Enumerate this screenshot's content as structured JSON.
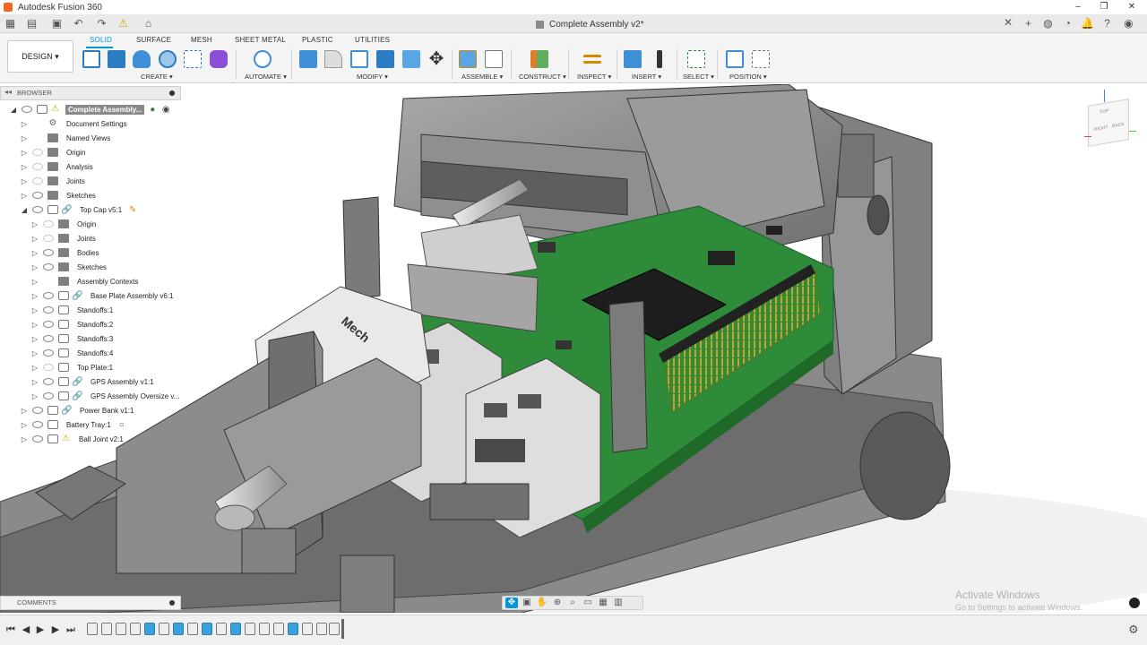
{
  "window": {
    "title": "Autodesk Fusion 360",
    "document_tab": "Complete Assembly v2*",
    "controls": [
      "–",
      "❐",
      "✕"
    ]
  },
  "toolbar": {
    "workspace": "DESIGN",
    "tabs": [
      "SOLID",
      "SURFACE",
      "MESH",
      "SHEET METAL",
      "PLASTIC",
      "UTILITIES"
    ],
    "active_tab": "SOLID",
    "groups": [
      "CREATE",
      "AUTOMATE",
      "MODIFY",
      "ASSEMBLE",
      "CONSTRUCT",
      "INSPECT",
      "INSERT",
      "SELECT",
      "POSITION"
    ]
  },
  "browser": {
    "title": "BROWSER",
    "root": "Complete Assembly...",
    "items": [
      {
        "label": "Document Settings",
        "icon": "gear-icon"
      },
      {
        "label": "Named Views",
        "icon": "folder-icon"
      },
      {
        "label": "Origin",
        "icon": "folder-icon"
      },
      {
        "label": "Analysis",
        "icon": "folder-icon"
      },
      {
        "label": "Joints",
        "icon": "folder-icon"
      },
      {
        "label": "Sketches",
        "icon": "folder-icon"
      },
      {
        "label": "Top Cap v5:1",
        "icon": "component-icon"
      },
      {
        "label": "Origin",
        "icon": "folder-icon"
      },
      {
        "label": "Joints",
        "icon": "folder-icon"
      },
      {
        "label": "Bodies",
        "icon": "folder-icon"
      },
      {
        "label": "Sketches",
        "icon": "folder-icon"
      },
      {
        "label": "Assembly Contexts",
        "icon": "folder-icon"
      },
      {
        "label": "Base Plate Assembly v6:1",
        "icon": "component-icon"
      },
      {
        "label": "Standoffs:1",
        "icon": "component-icon"
      },
      {
        "label": "Standoffs:2",
        "icon": "component-icon"
      },
      {
        "label": "Standoffs:3",
        "icon": "component-icon"
      },
      {
        "label": "Standoffs:4",
        "icon": "component-icon"
      },
      {
        "label": "Top Plate:1",
        "icon": "component-icon"
      },
      {
        "label": "GPS Assembly v1:1",
        "icon": "component-icon"
      },
      {
        "label": "GPS Assembly Oversize v...",
        "icon": "component-icon"
      },
      {
        "label": "Power Bank v1:1",
        "icon": "component-icon"
      },
      {
        "label": "Battery Tray:1",
        "icon": "component-icon"
      },
      {
        "label": "Ball Joint v2:1",
        "icon": "component-icon"
      }
    ]
  },
  "comments": {
    "title": "COMMENTS"
  },
  "viewcube": {
    "faces": [
      "TOP",
      "RIGHT",
      "BACK"
    ]
  },
  "watermark": {
    "line1": "Activate Windows",
    "line2": "Go to Settings to activate Windows."
  },
  "colors": {
    "accent": "#0696d7",
    "pcb_green": "#2e8b3a",
    "housing_gray": "#8c8c8c",
    "warning": "#d4a800"
  }
}
